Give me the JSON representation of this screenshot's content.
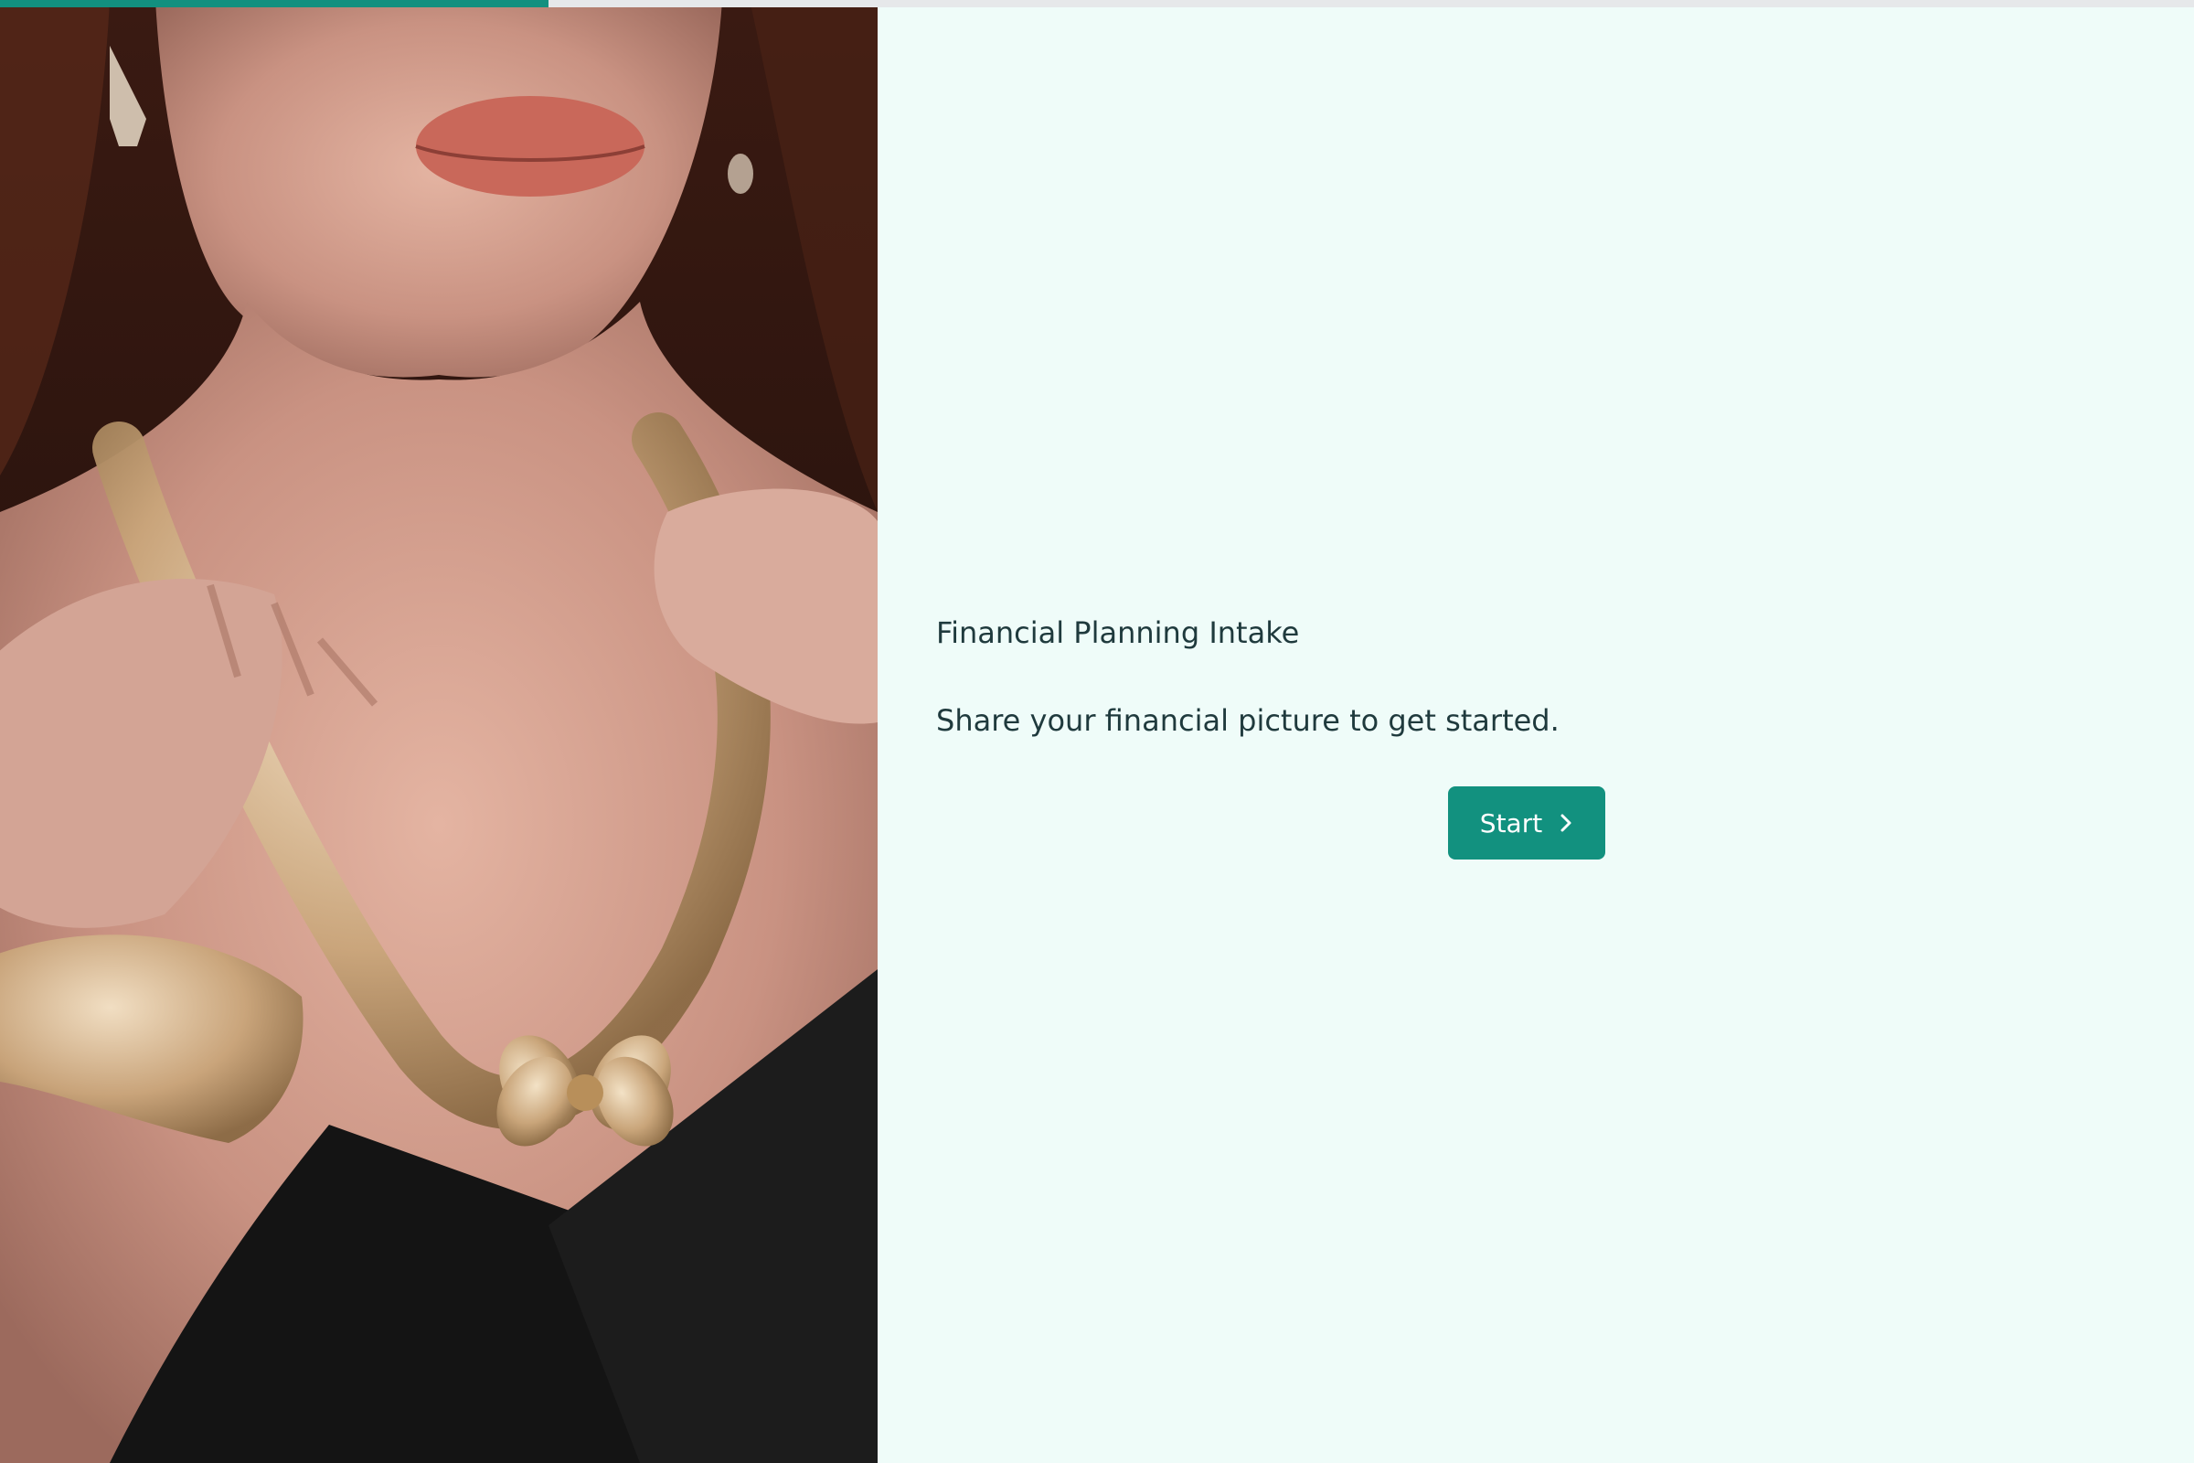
{
  "progress": {
    "value_percent": 25,
    "color": "#12907f"
  },
  "hero_image": {
    "alt": "woman wearing crystal necklace and bracelet"
  },
  "intake": {
    "title": "Financial Planning Intake",
    "subtitle": "Share your financial picture to get started."
  },
  "start_button": {
    "label": "Start",
    "icon": "chevron-right-icon",
    "color": "#12917f"
  },
  "colors": {
    "page_background": "#effcf9",
    "text": "#1f3a3d"
  }
}
